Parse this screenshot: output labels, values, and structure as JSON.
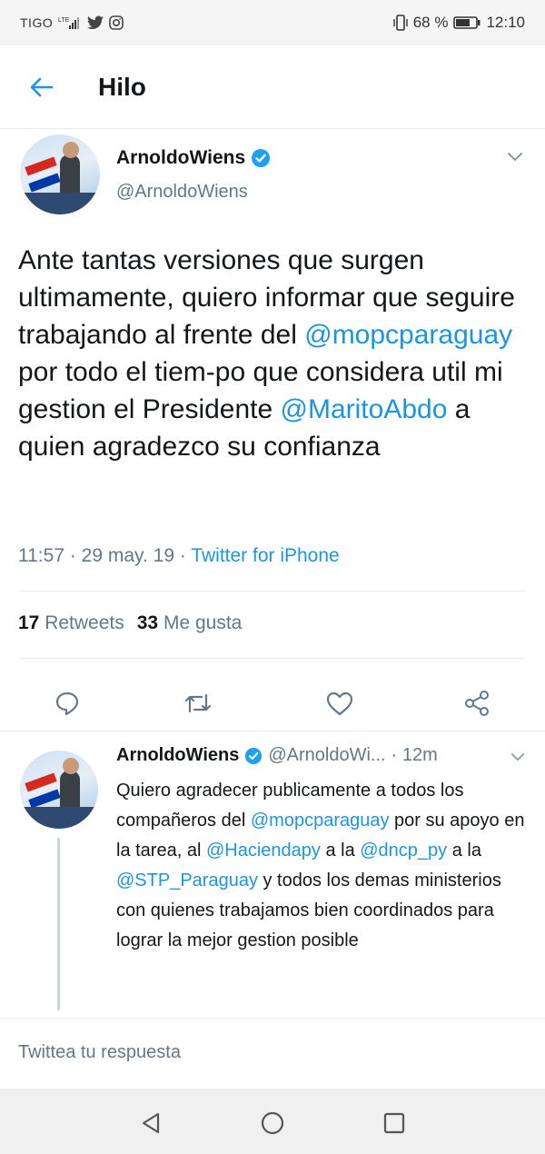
{
  "status_bar": {
    "carrier": "TIGO",
    "network": "LTE",
    "battery": "68 %",
    "time": "12:10"
  },
  "header": {
    "title": "Hilo"
  },
  "tweet": {
    "author_name": "ArnoldoWiens",
    "author_handle": "@ArnoldoWiens",
    "text_parts": {
      "p1": "Ante tantas versiones que surgen ultimamente, quiero informar que seguire trabajando al frente del ",
      "m1": "@mopcparaguay",
      "p2": " por todo el tiem-po que considera util mi gestion el Presidente ",
      "m2": "@MaritoAbdo",
      "p3": " a quien agradezco su confianza"
    },
    "time": "11:57",
    "date": "29 may. 19",
    "source": "Twitter for iPhone",
    "retweets_count": "17",
    "retweets_label": "Retweets",
    "likes_count": "33",
    "likes_label": "Me gusta"
  },
  "reply": {
    "author_name": "ArnoldoWiens",
    "author_handle": "@ArnoldoWi...",
    "age": "· 12m",
    "text_parts": {
      "p1": "Quiero agradecer publicamente a todos los compañeros del ",
      "m1": "@mopcparaguay",
      "p2": " por su apoyo en la tarea, al ",
      "m2": "@Haciendapy",
      "p3": " a la ",
      "m3": "@dncp_py",
      "p4": " a la ",
      "m4": "@STP_Paraguay",
      "p5": " y todos los demas ministerios con quienes trabajamos bien coordinados para lograr la mejor gestion posible"
    }
  },
  "compose": {
    "placeholder": "Twittea tu respuesta"
  },
  "colors": {
    "accent": "#1b95e0",
    "secondary_text": "#657786",
    "divider": "#e6ecf0"
  }
}
